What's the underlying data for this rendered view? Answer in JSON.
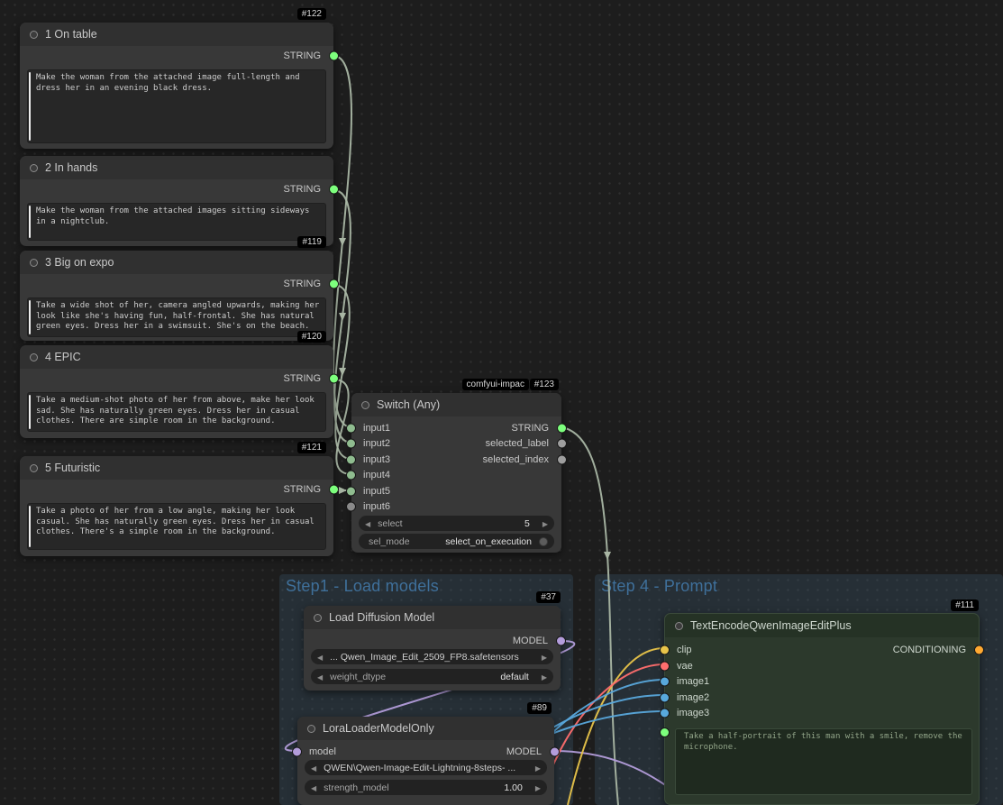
{
  "prompt_nodes": [
    {
      "badge": "#122",
      "title": "1 On table",
      "output": "STRING",
      "text": "Make the woman from the attached image full-length and dress her in an evening black dress."
    },
    {
      "badge": "",
      "title": "2 In hands",
      "output": "STRING",
      "text": "Make the woman from the attached images sitting sideways in a nightclub."
    },
    {
      "badge": "#119",
      "title": "3 Big on expo",
      "output": "STRING",
      "text": "Take a wide shot of her, camera angled upwards, making her look like she's having fun, half-frontal. She has natural green eyes. Dress her in a swimsuit. She's on the beach."
    },
    {
      "badge": "#120",
      "title": "4 EPIC",
      "output": "STRING",
      "text": "Take a medium-shot photo of her from above, make her look sad. She has naturally green eyes. Dress her in casual clothes. There are simple room in the background."
    },
    {
      "badge": "#121",
      "title": "5 Futuristic",
      "output": "STRING",
      "text": "Take a photo of her from a low angle, making her look casual. She has naturally green eyes. Dress her in casual clothes. There's a simple room in the background."
    }
  ],
  "switch_node": {
    "pack_badge": "comfyui-impac",
    "badge": "#123",
    "title": "Switch (Any)",
    "inputs": [
      "input1",
      "input2",
      "input3",
      "input4",
      "input5",
      "input6"
    ],
    "outputs": [
      "STRING",
      "selected_label",
      "selected_index"
    ],
    "select": {
      "label": "select",
      "value": "5"
    },
    "sel_mode": {
      "label": "sel_mode",
      "value": "select_on_execution"
    }
  },
  "groups": {
    "step1": {
      "title": "Step1 - Load models"
    },
    "step4": {
      "title": "Step 4 - Prompt"
    }
  },
  "load_diffusion_node": {
    "badge": "#37",
    "title": "Load Diffusion Model",
    "output": "MODEL",
    "ckpt_value": "... Qwen_Image_Edit_2509_FP8.safetensors",
    "weight_dtype_label": "weight_dtype",
    "weight_dtype_value": "default"
  },
  "lora_node": {
    "badge": "#89",
    "title": "LoraLoaderModelOnly",
    "input": "model",
    "output": "MODEL",
    "lora_value": "QWEN\\Qwen-Image-Edit-Lightning-8steps- ...",
    "strength_label": "strength_model",
    "strength_value": "1.00"
  },
  "text_encode_node": {
    "badge": "#111",
    "title": "TextEncodeQwenImageEditPlus",
    "inputs": [
      "clip",
      "vae",
      "image1",
      "image2",
      "image3"
    ],
    "output": "CONDITIONING",
    "text": "Take a half-portrait of this man with a smile, remove the microphone."
  },
  "colors": {
    "string_port": "#7dff7d",
    "model_port": "#b39ddb",
    "clip_port": "#e8c44a",
    "vae_port": "#ff6e6e",
    "image_port": "#58a8dc",
    "conditioning_port": "#ffa931",
    "string_link": "#a9b6a4",
    "group_title": "#3f709b"
  }
}
